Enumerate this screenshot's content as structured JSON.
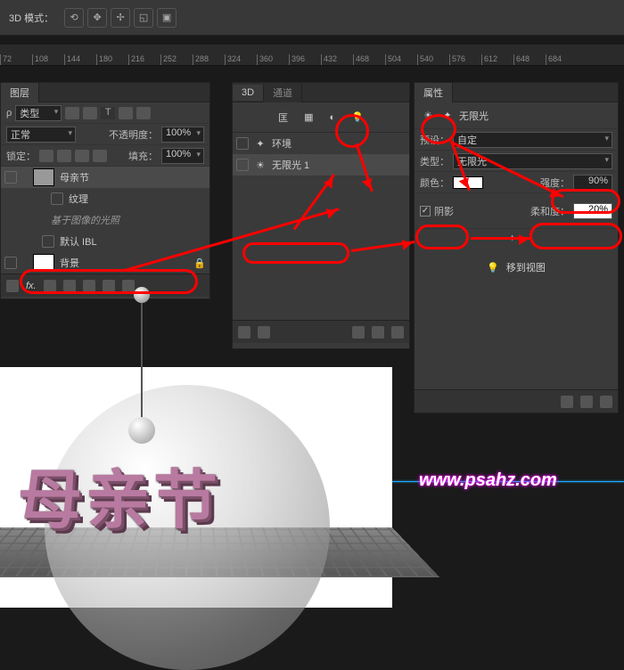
{
  "topbar": {
    "mode_label": "3D 模式："
  },
  "ruler": {
    "ticks": [
      "72",
      "108",
      "144",
      "180",
      "216",
      "252",
      "288",
      "324",
      "360",
      "396",
      "432",
      "468",
      "504",
      "540",
      "576",
      "612",
      "648",
      "684"
    ]
  },
  "layers_panel": {
    "title": "图层",
    "filter_label": "类型",
    "blend_label": "正常",
    "opacity_label": "不透明度：",
    "opacity_value": "100%",
    "lock_label": "锁定：",
    "fill_label": "填充：",
    "fill_value": "100%",
    "items": [
      {
        "name": "母亲节",
        "active": true
      },
      {
        "name": "纹理"
      },
      {
        "name": "基于图像的光照",
        "italic": true
      },
      {
        "name": "默认 IBL"
      },
      {
        "name": "背景"
      }
    ]
  },
  "three_d_panel": {
    "title": "3D",
    "tab2": "通道",
    "items": [
      {
        "name": "环境"
      },
      {
        "name": "无限光 1",
        "active": true
      }
    ]
  },
  "props_panel": {
    "title": "属性",
    "light_type": "无限光",
    "preset_label": "预设：",
    "preset_value": "自定",
    "type_label": "类型：",
    "type_value": "无限光",
    "color_label": "颜色：",
    "intensity_label": "强度：",
    "intensity_value": "90%",
    "shadow_label": "阴影",
    "softness_label": "柔和度：",
    "softness_value": "20%",
    "move_btn": "移到视图"
  },
  "canvas": {
    "text": "母亲节"
  },
  "watermark": "www.psahz.com"
}
